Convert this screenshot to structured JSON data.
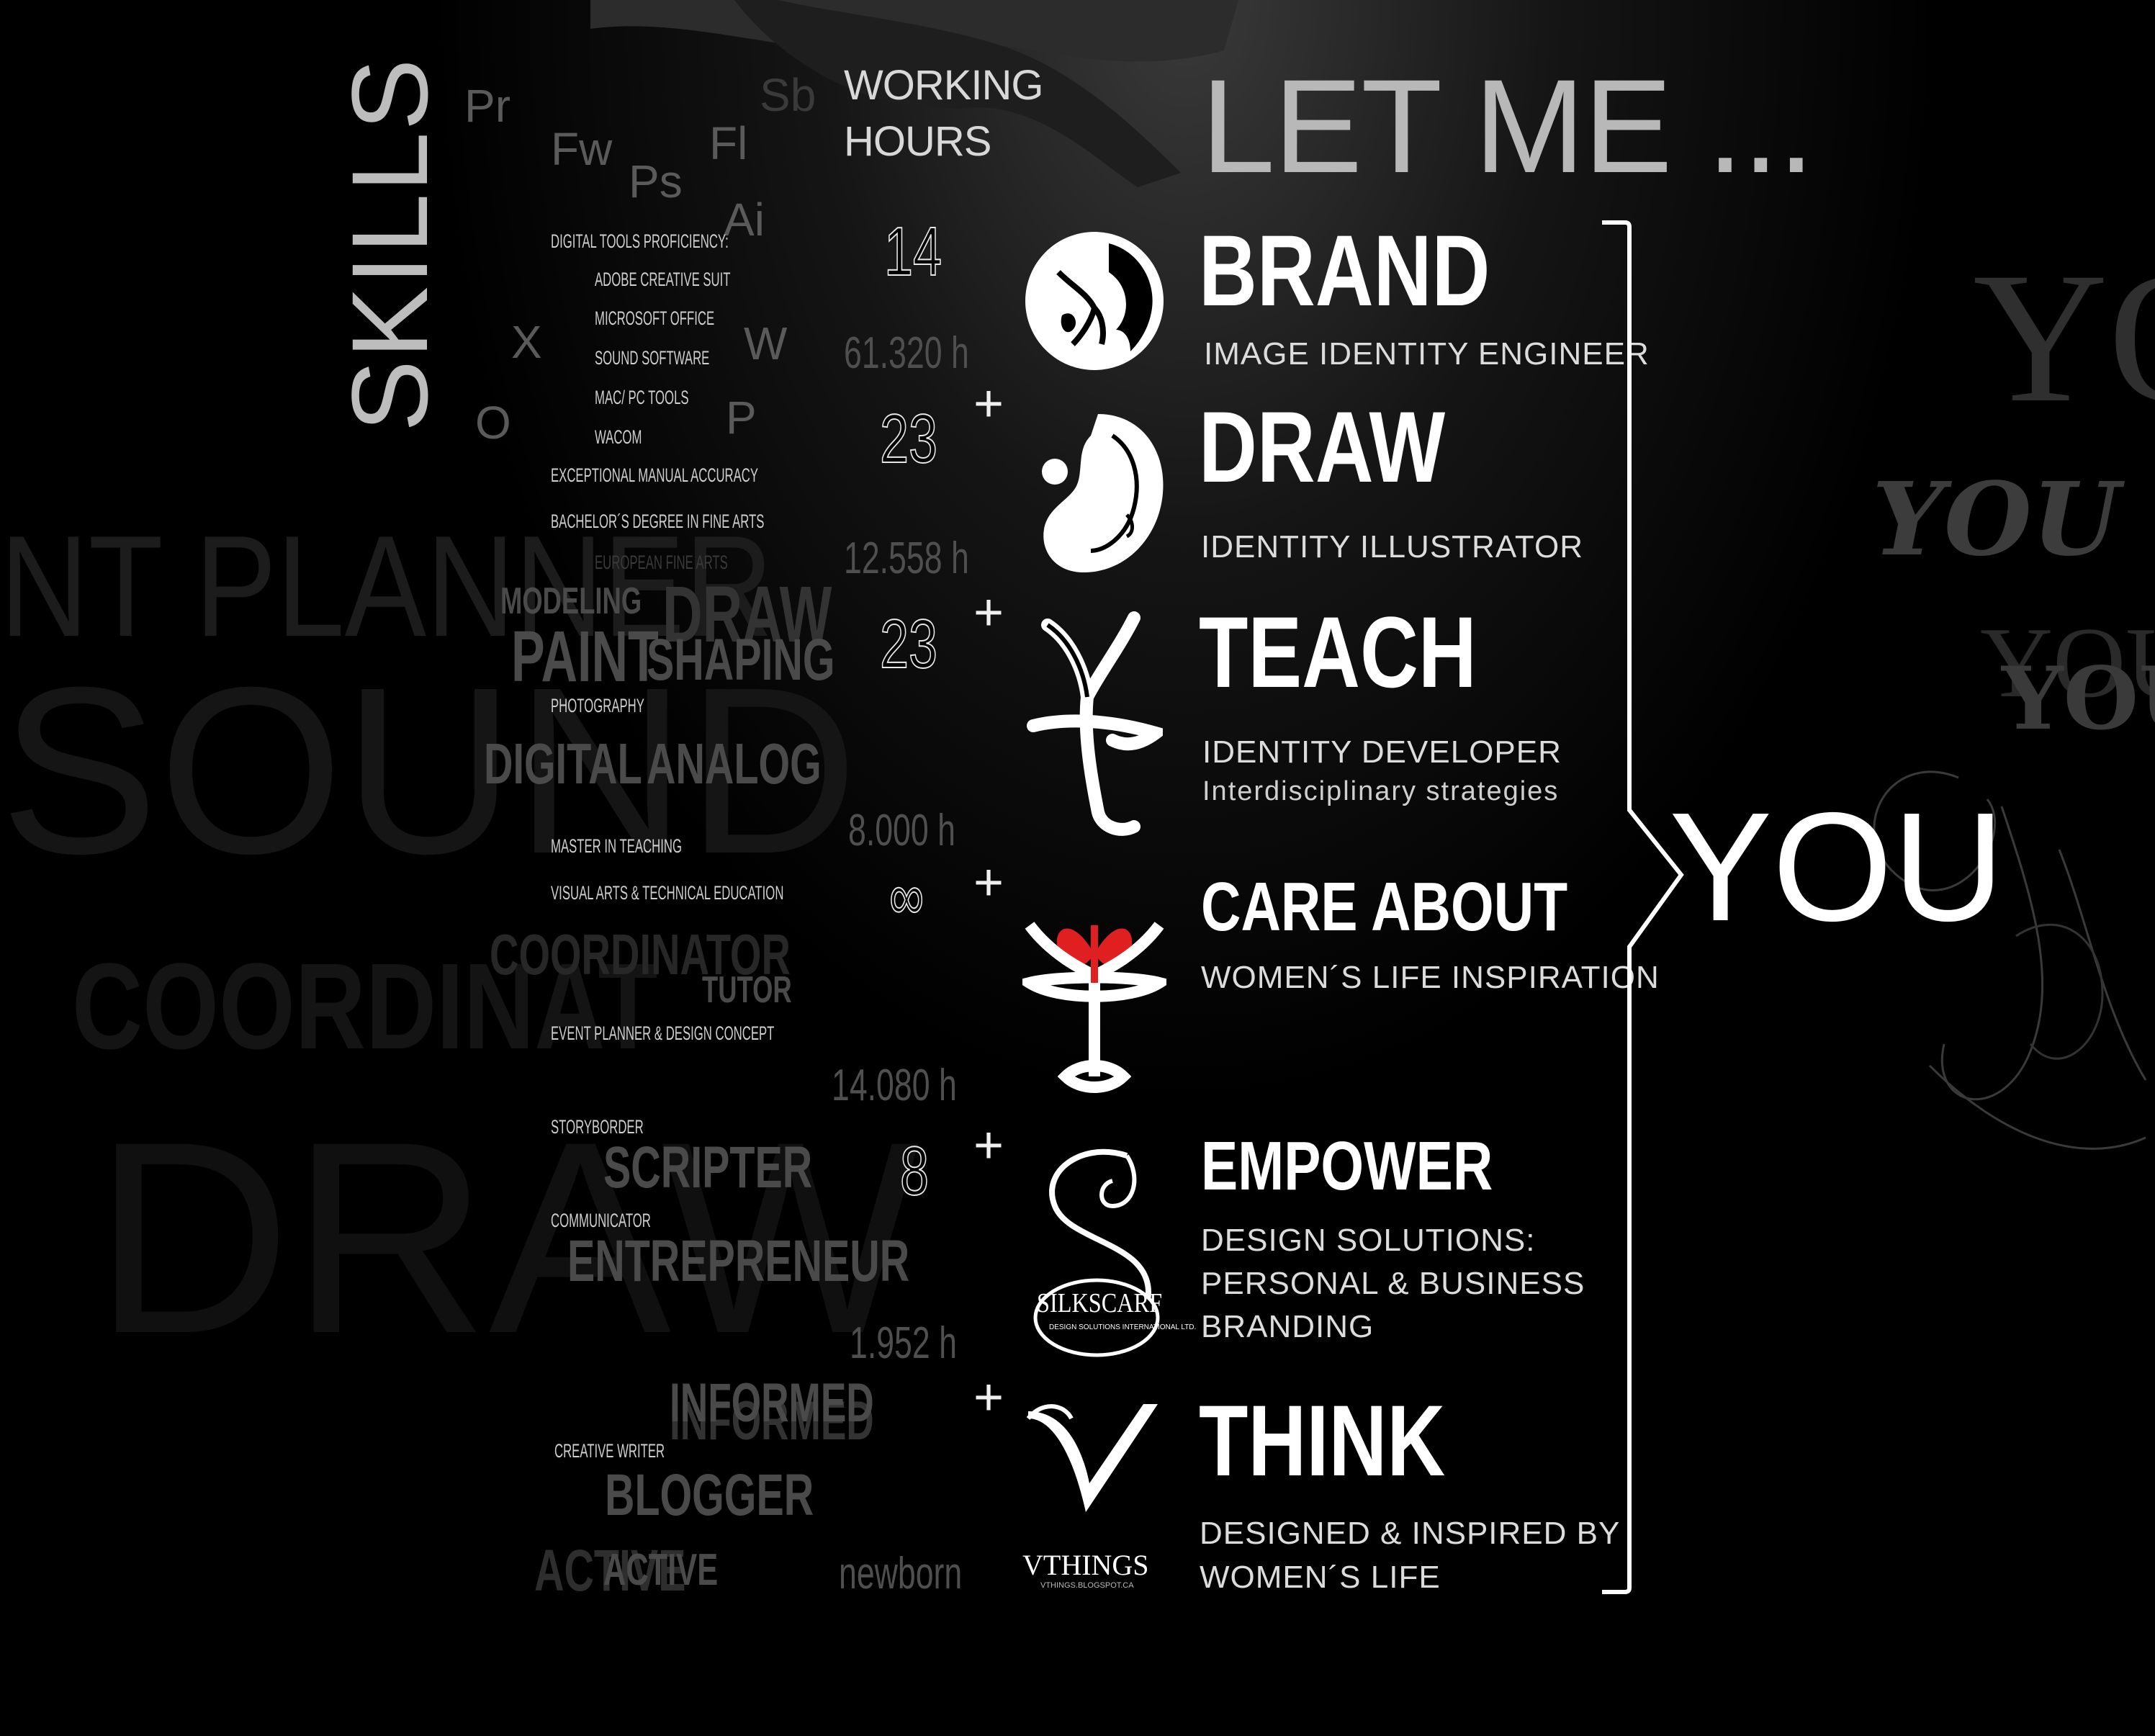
{
  "background_words": {
    "planner": "NT PLANNER",
    "sound": "SOUND",
    "coordinator": "COORDINAT",
    "draw": "DRAW",
    "you_stack": [
      "YOU",
      "YOU",
      "YOU",
      "YOU"
    ]
  },
  "skills": {
    "vertical_title": "SKILLS",
    "app_letters": [
      "Pr",
      "Fw",
      "Ps",
      "Fl",
      "Sb",
      "Ai",
      "X",
      "O",
      "W",
      "P"
    ],
    "lines": [
      "DIGITAL TOOLS PROFICIENCY:",
      "ADOBE CREATIVE SUIT",
      "MICROSOFT OFFICE",
      "SOUND SOFTWARE",
      "MAC/ PC TOOLS",
      "WACOM",
      "EXCEPTIONAL MANUAL ACCURACY",
      "BACHELOR´S DEGREE IN FINE ARTS",
      "EUROPEAN FINE ARTS",
      "PHOTOGRAPHY",
      "MASTER IN TEACHING",
      "VISUAL ARTS & TECHNICAL EDUCATION",
      "EVENT  PLANNER & DESIGN CONCEPT",
      "STORYBORDER",
      "COMMUNICATOR",
      "CREATIVE WRITER"
    ],
    "words": {
      "modeling": "MODELING",
      "draw": "DRAW",
      "paint": "PAINT",
      "shaping": "SHAPING",
      "digital": "DIGITAL",
      "analog": "ANALOG",
      "coordinator": "COORDINATOR",
      "tutor": "TUTOR",
      "scripter": "SCRIPTER",
      "entrepreneur": "ENTREPRENEUR",
      "informed": "INFORMED",
      "blogger": "BLOGGER",
      "active1": "ACTIVE",
      "active2": "ACTIVE"
    }
  },
  "working_hours": {
    "label_line1": "WORKING",
    "label_line2": "HOURS",
    "numbers": [
      "14",
      "23",
      "23",
      "∞",
      "8"
    ],
    "plus": "+",
    "totals": [
      "61.320 h",
      "12.558 h",
      "8.000  h",
      "14.080  h",
      "1.952  h",
      "newborn"
    ]
  },
  "let_me": {
    "heading": "LET ME ...",
    "items": [
      {
        "title": "BRAND",
        "subtitle": "IMAGE IDENTITY ENGINEER"
      },
      {
        "title": "DRAW",
        "subtitle": "IDENTITY ILLUSTRATOR"
      },
      {
        "title": "TEACH",
        "subtitle": "IDENTITY DEVELOPER",
        "subtitle2": "Interdisciplinary strategies"
      },
      {
        "title": "CARE ABOUT",
        "subtitle": "WOMEN´S LIFE INSPIRATION"
      },
      {
        "title": "EMPOWER",
        "subtitle": "DESIGN SOLUTIONS:",
        "subtitle2": "PERSONAL & BUSINESS",
        "subtitle3": "BRANDING"
      },
      {
        "title": "THINK",
        "subtitle": "DESIGNED & INSPIRED BY",
        "subtitle2": "WOMEN´S LIFE"
      }
    ],
    "target": "YOU"
  },
  "logos": {
    "silkscarf_name": "SILKSCARF",
    "silkscarf_tagline": "DESIGN SOLUTIONS INTERNATIONAL LTD.",
    "vthings_name": "VTHINGS",
    "vthings_url": "VTHINGS.BLOGSPOT.CA"
  },
  "colors": {
    "background": "#000000",
    "accent_red": "#e02020",
    "text_white": "#ffffff",
    "text_grey": "#4a4a4a"
  }
}
